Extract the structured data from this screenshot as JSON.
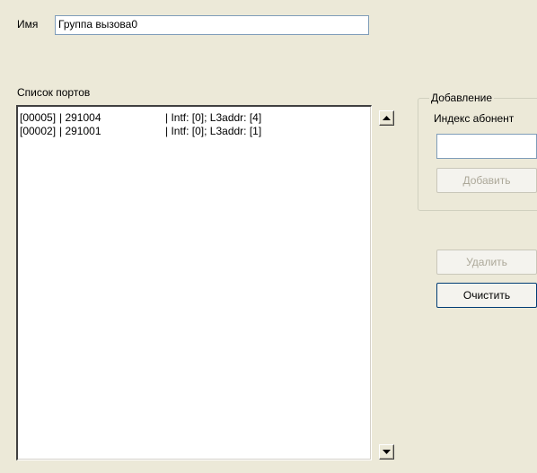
{
  "name_label": "Имя",
  "name_value": "Группа вызова0",
  "ports_label": "Список портов",
  "ports": [
    {
      "id": "[00005]",
      "number": "| 291004",
      "info": "| Intf: [0]; L3addr: [4]"
    },
    {
      "id": "[00002]",
      "number": "| 291001",
      "info": "| Intf: [0]; L3addr: [1]"
    }
  ],
  "add_group": {
    "title": "Добавление",
    "index_label": "Индекс абонент",
    "index_value": "",
    "add_button": "Добавить"
  },
  "delete_button": "Удалить",
  "clear_button": "Очистить",
  "icons": {
    "scroll_up": "triangle-up",
    "scroll_down": "triangle-down"
  }
}
